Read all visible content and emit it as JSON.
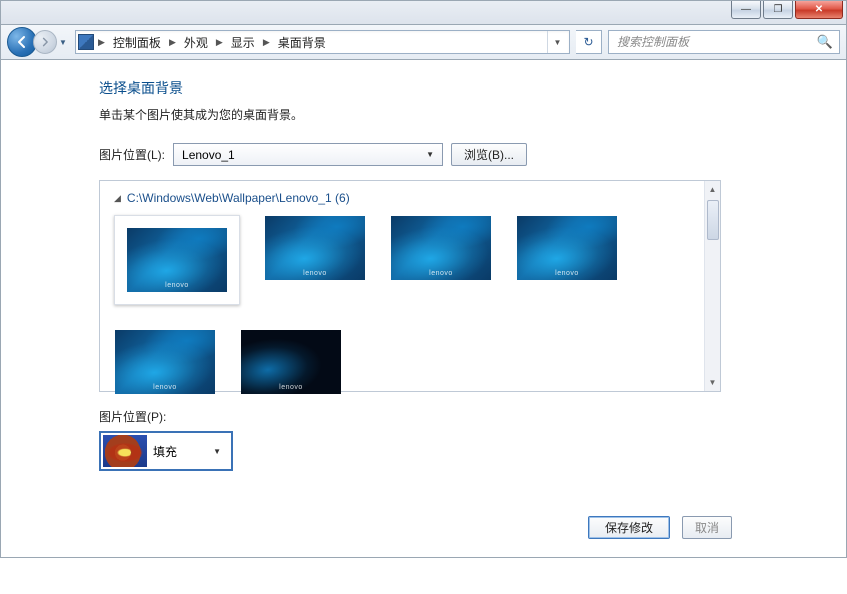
{
  "titlebar": {
    "minimize": "—",
    "maximize": "❐",
    "close": "✕"
  },
  "toolbar": {
    "back_arrow": "←",
    "fwd_arrow": "→",
    "refresh": "↻",
    "search_placeholder": "搜索控制面板",
    "breadcrumb": [
      "控制面板",
      "外观",
      "显示",
      "桌面背景"
    ]
  },
  "page": {
    "heading": "选择桌面背景",
    "subtext": "单击某个图片使其成为您的桌面背景。",
    "location_label": "图片位置(L):",
    "location_value": "Lenovo_1",
    "browse_label": "浏览(B)...",
    "group_path": "C:\\Windows\\Web\\Wallpaper\\Lenovo_1 (6)",
    "brand": "lenovo",
    "position_label": "图片位置(P):",
    "position_value": "填充",
    "save_label": "保存修改",
    "cancel_label": "取消"
  }
}
